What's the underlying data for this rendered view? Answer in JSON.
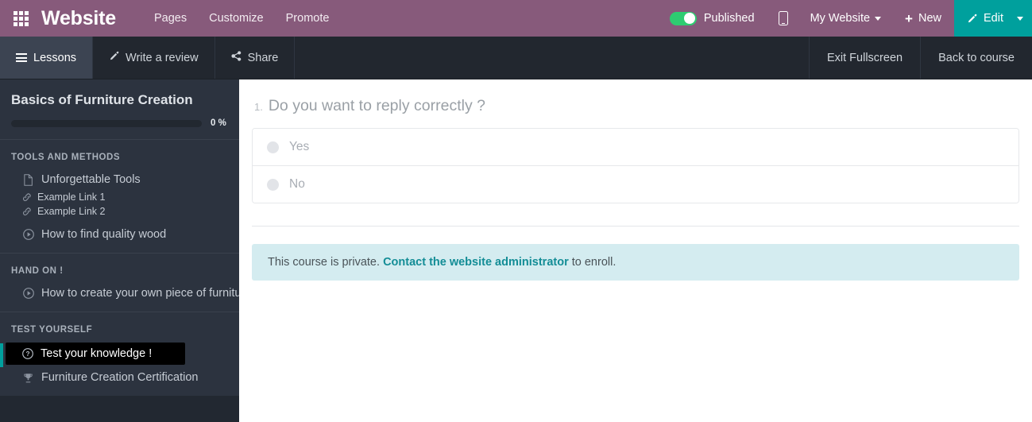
{
  "topbar": {
    "apps_icon": "apps-grid-icon",
    "brand": "Website",
    "menu": [
      {
        "label": "Pages"
      },
      {
        "label": "Customize"
      },
      {
        "label": "Promote"
      }
    ],
    "published_label": "Published",
    "published_state": "on",
    "mobile_icon": "mobile-preview-icon",
    "website_selector": "My Website",
    "new_label": "New",
    "edit_label": "Edit",
    "accent_purple": "#875A7B",
    "accent_teal": "#00A09D",
    "toggle_green": "#2ecc71"
  },
  "subbar": {
    "left_items": [
      {
        "label": "Lessons",
        "icon": "hamburger-icon",
        "active": true
      },
      {
        "label": "Write a review",
        "icon": "pencil-icon",
        "active": false
      },
      {
        "label": "Share",
        "icon": "share-icon",
        "active": false
      }
    ],
    "right_items": [
      {
        "label": "Exit Fullscreen"
      },
      {
        "label": "Back to course"
      }
    ]
  },
  "sidebar": {
    "course_title": "Basics of Furniture Creation",
    "progress_percent": "0 %",
    "progress_value": 0,
    "sections": [
      {
        "title": "TOOLS AND METHODS",
        "items": [
          {
            "label": "Unforgettable Tools",
            "icon": "document-icon",
            "size": "normal",
            "selected": false
          },
          {
            "label": "Example Link 1",
            "icon": "link-icon",
            "size": "small",
            "selected": false
          },
          {
            "label": "Example Link 2",
            "icon": "link-icon",
            "size": "small",
            "selected": false
          },
          {
            "label": "How to find quality wood",
            "icon": "play-circle-icon",
            "size": "normal",
            "selected": false
          }
        ]
      },
      {
        "title": "HAND ON !",
        "items": [
          {
            "label": "How to create your own piece of furniture",
            "icon": "play-circle-icon",
            "size": "normal",
            "selected": false
          }
        ]
      },
      {
        "title": "TEST YOURSELF",
        "items": [
          {
            "label": "Test your knowledge !",
            "icon": "question-circle-icon",
            "size": "normal",
            "selected": true
          },
          {
            "label": "Furniture Creation Certification",
            "icon": "trophy-icon",
            "size": "normal",
            "selected": false
          }
        ]
      }
    ]
  },
  "main": {
    "question_number": "1.",
    "question_text": "Do you want to reply correctly ?",
    "answers": [
      {
        "label": "Yes"
      },
      {
        "label": "No"
      }
    ],
    "alert": {
      "text_before": "This course is private.",
      "link_text": "Contact the website administrator",
      "text_after": "to enroll."
    }
  }
}
